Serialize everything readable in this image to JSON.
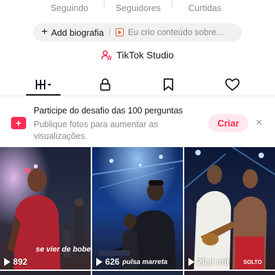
{
  "stats": [
    {
      "label": "Seguindo"
    },
    {
      "label": "Seguidores"
    },
    {
      "label": "Curtidas"
    }
  ],
  "bio": {
    "add_label": "Add biografia",
    "hint": "Eu crio conteúdo sobre..."
  },
  "studio": {
    "label": "TikTok Studio"
  },
  "tabs": [
    {
      "icon": "videos-grid-icon"
    },
    {
      "icon": "lock-icon"
    },
    {
      "icon": "bookmark-icon"
    },
    {
      "icon": "heart-icon"
    }
  ],
  "banner": {
    "title": "Participe do desafio das 100 perguntas",
    "desc": "Publique fotos para aumentar as visualizações.",
    "cta": "Criar",
    "close": "×"
  },
  "videos": [
    {
      "views": "892",
      "overlay_text": "se vier de bobeira"
    },
    {
      "views": "626",
      "overlay_text": "pulsa marreta"
    },
    {
      "views": "20,9 mil",
      "overlay_text": "SOLTO"
    }
  ],
  "colors": {
    "accent": "#fe2c55",
    "accent_soft": "#ffe8ec",
    "muted_text": "#8a8b91",
    "pill_bg": "#f1f1f2"
  }
}
